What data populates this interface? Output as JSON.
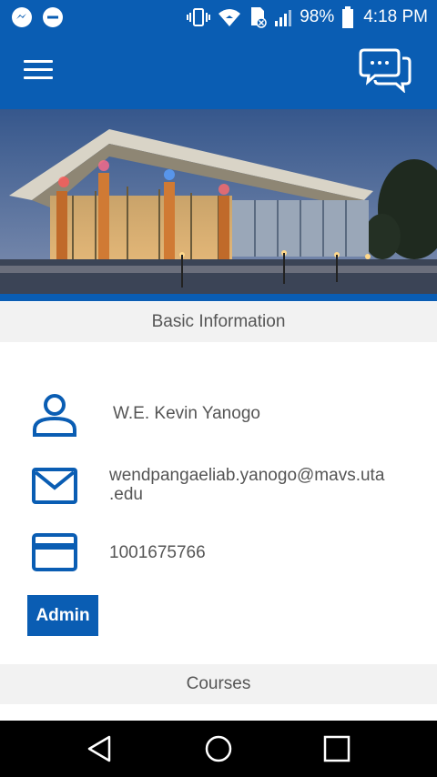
{
  "status_bar": {
    "left_icons": [
      "messenger-icon",
      "do-not-disturb-icon"
    ],
    "right_icons": [
      "vibrate-icon",
      "wifi-icon",
      "no-sim-icon",
      "signal-icon",
      "battery-icon"
    ],
    "battery_percent": "98%",
    "time": "4:18 PM"
  },
  "app_bar": {
    "menu_icon": "menu-icon",
    "chat_icon": "chat-bubbles-icon",
    "background_color": "#0a5db3"
  },
  "hero": {
    "image": "campus-building-night-photo"
  },
  "basic_info": {
    "header": "Basic Information",
    "name": "W.E. Kevin Yanogo",
    "email_line1": "wendpangaeliab.yanogo@mavs.uta",
    "email_line2": ".edu",
    "student_id": "1001675766",
    "admin_label": "Admin",
    "icons": [
      "person-icon",
      "mail-icon",
      "card-icon"
    ]
  },
  "courses": {
    "header": "Courses"
  },
  "nav_bar": {
    "icons": [
      "back-icon",
      "home-icon",
      "recents-icon"
    ]
  },
  "colors": {
    "accent": "#0a5db3",
    "section_bg": "#f2f2f2",
    "text": "#555555"
  }
}
